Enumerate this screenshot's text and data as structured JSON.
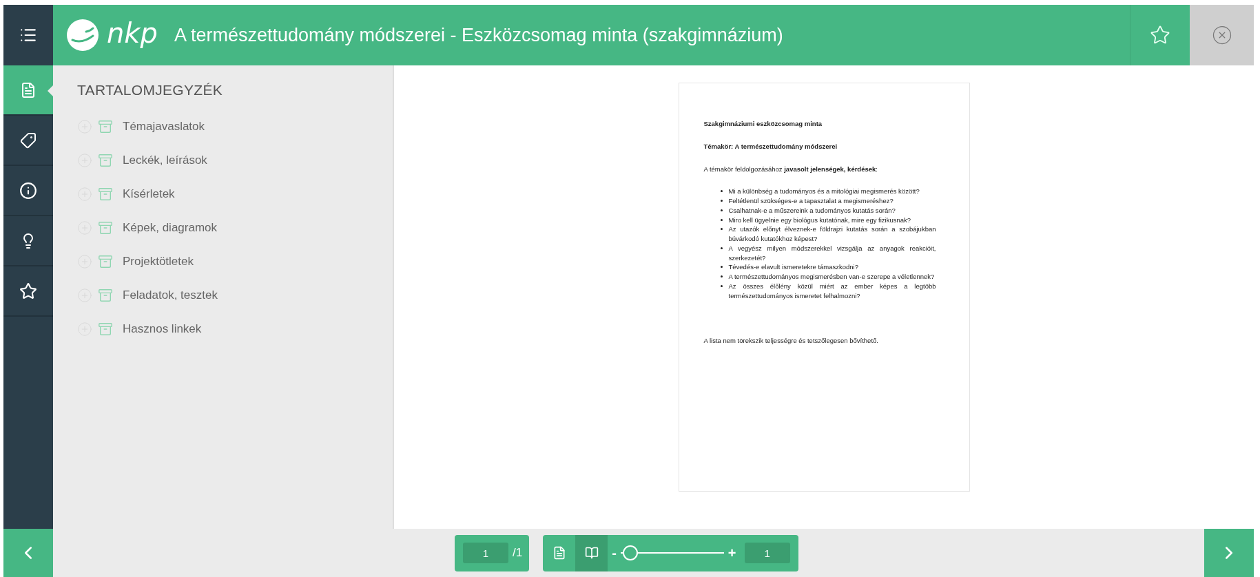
{
  "header": {
    "logo_text": "nkp",
    "title": "A természettudomány módszerei - Eszközcsomag minta (szakgimnázium)"
  },
  "rail_tabs": [
    {
      "kind": "contents",
      "selected": true
    },
    {
      "kind": "tags",
      "selected": false
    },
    {
      "kind": "info",
      "selected": false
    },
    {
      "kind": "ideas",
      "selected": false
    },
    {
      "kind": "favorites",
      "selected": false
    }
  ],
  "toc": {
    "title": "TARTALOMJEGYZÉK",
    "items": [
      {
        "label": "Témajavaslatok"
      },
      {
        "label": "Leckék, leírások"
      },
      {
        "label": "Kísérletek"
      },
      {
        "label": "Képek, diagramok"
      },
      {
        "label": "Projektötletek"
      },
      {
        "label": "Feladatok, tesztek"
      },
      {
        "label": "Hasznos linkek"
      }
    ]
  },
  "document": {
    "heading": "Szakgimnáziumi eszközcsomag minta",
    "topic": "Témakör: A természettudomány módszerei",
    "intro": "A témakör feldolgozásához **javasolt jelenségek, kérdések**:",
    "bullets": [
      "Mi a különbség a tudományos és a mitológiai megismerés között?",
      "Feltétlenül szükséges-e a tapasztalat a megismeréshez?",
      "Csalhatnak-e a műszereink a tudományos kutatás során?",
      "Miro kell ügyelnie egy biológus kutatónak, mire egy fizikusnak?",
      "Az utazók előnyt élveznek-e földrajzi kutatás során a szobájukban búvárkodó kutatókhoz képest?",
      "A vegyész milyen módszerekkel vizsgálja az anyagok reakcióit, szerkezetét?",
      "Tévedés-e elavult ismeretekre támaszkodni?",
      "A természettudományos megismerésben van-e szerepe a véletlennek?",
      "Az összes élőlény közül miért az ember képes a legtöbb természettudományos ismeretet felhalmozni?"
    ],
    "footer": "A lista nem törekszik teljességre és tetszőlegesen bővíthető."
  },
  "pager": {
    "page": "1",
    "total": "/1"
  },
  "view_modes": [
    {
      "kind": "single",
      "selected": false
    },
    {
      "kind": "book",
      "selected": true
    }
  ],
  "zoom": {
    "minus": "-",
    "plus": "+",
    "level": 0.02,
    "value": "1"
  }
}
